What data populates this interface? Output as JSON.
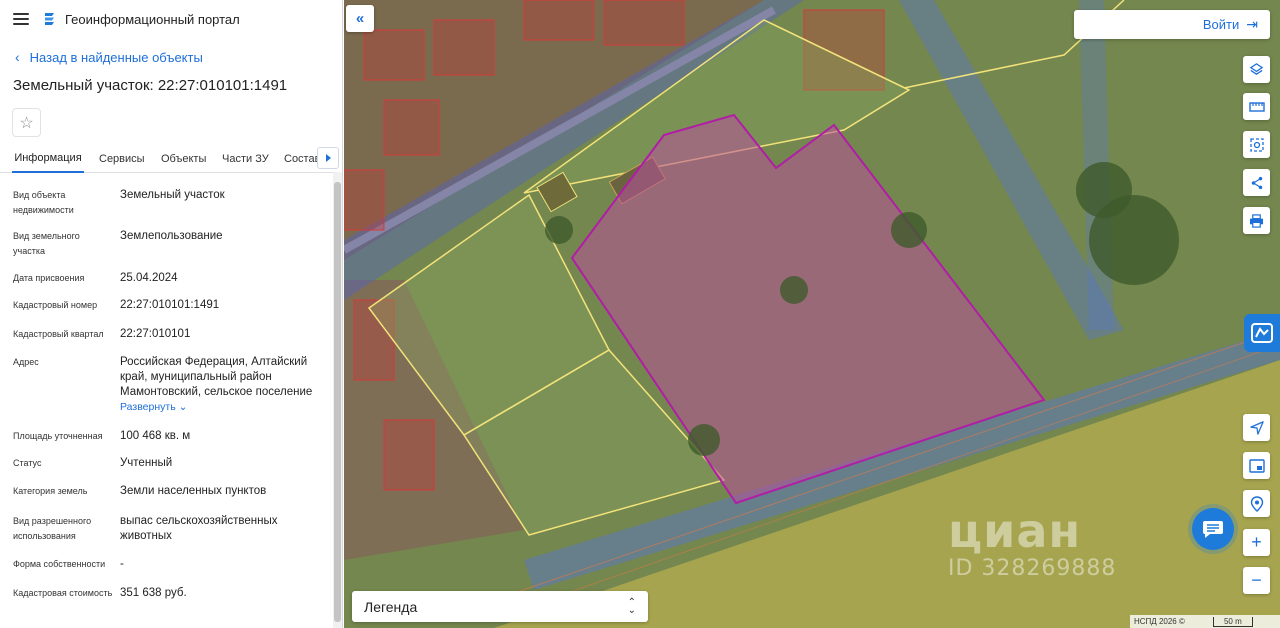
{
  "header": {
    "portal_title": "Геоинформационный портал"
  },
  "nav": {
    "back_label": "Назад в найденные объекты"
  },
  "object": {
    "title": "Земельный участок: 22:27:010101:1491"
  },
  "tabs": [
    {
      "label": "Информация",
      "active": true
    },
    {
      "label": "Сервисы"
    },
    {
      "label": "Объекты"
    },
    {
      "label": "Части ЗУ"
    },
    {
      "label": "Состав"
    }
  ],
  "properties": [
    {
      "label": "Вид объекта недвижимости",
      "value": "Земельный участок"
    },
    {
      "label": "Вид земельного участка",
      "value": "Землепользование"
    },
    {
      "label": "Дата присвоения",
      "value": "25.04.2024"
    },
    {
      "label": "Кадастровый номер",
      "value": "22:27:010101:1491"
    },
    {
      "label": "Кадастровый квартал",
      "value": "22:27:010101"
    },
    {
      "label": "Адрес",
      "value": "Российская Федерация, Алтайский край, муниципальный район Мамонтовский, сельское поселение",
      "expand_label": "Развернуть"
    },
    {
      "label": "Площадь уточненная",
      "value": "100 468 кв. м"
    },
    {
      "label": "Статус",
      "value": "Учтенный"
    },
    {
      "label": "Категория земель",
      "value": "Земли населенных пунктов"
    },
    {
      "label": "Вид разрешенного использования",
      "value": "выпас сельскохозяйственных животных"
    },
    {
      "label": "Форма собственности",
      "value": "-"
    },
    {
      "label": "Кадастровая стоимость",
      "value": "351 638 руб."
    }
  ],
  "map": {
    "login_label": "Войти",
    "legend_label": "Легенда",
    "watermark_brand": "циан",
    "watermark_id": "ID 328269888",
    "attribution": "НСПД 2026 ©",
    "scale_label": "50 m",
    "colors": {
      "accent": "#1e6fd9",
      "selected_parcel": "#b01ea6",
      "parcel_outline": "#f2e27a",
      "zone_blue": "#4f5fd0",
      "zone_red": "#c23a3a"
    }
  },
  "icons": {
    "collapse": "double-chevron-left-icon",
    "layers": "layers-icon",
    "ruler": "ruler-icon",
    "select_area": "select-area-icon",
    "share": "share-icon",
    "print": "print-icon",
    "location": "location-arrow-icon",
    "minimap": "minimap-icon",
    "geo_pin": "geo-pin-icon",
    "zoom_in": "plus-icon",
    "zoom_out": "minus-icon",
    "chat": "chat-icon"
  }
}
